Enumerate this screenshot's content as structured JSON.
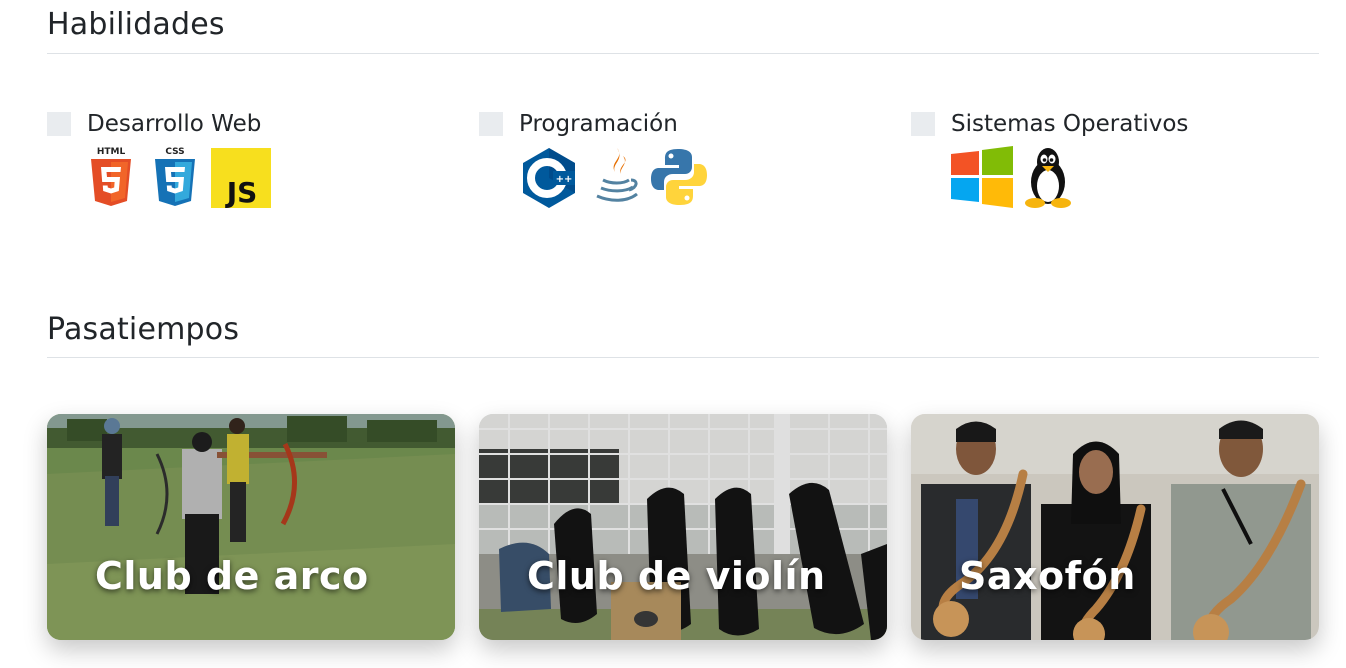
{
  "skills_section": {
    "title": "Habilidades",
    "groups": [
      {
        "label": "Desarrollo Web",
        "icons": [
          "html5-icon",
          "css3-icon",
          "javascript-icon"
        ],
        "icon_text": {
          "html": "HTML",
          "css": "CSS",
          "js": "JS"
        }
      },
      {
        "label": "Programación",
        "icons": [
          "cplusplus-icon",
          "java-icon",
          "python-icon"
        ]
      },
      {
        "label": "Sistemas Operativos",
        "icons": [
          "windows-icon",
          "linux-tux-icon"
        ]
      }
    ]
  },
  "hobbies_section": {
    "title": "Pasatiempos",
    "cards": [
      {
        "title": "Club de arco"
      },
      {
        "title": "Club de violín"
      },
      {
        "title": "Saxofón"
      }
    ]
  },
  "colors": {
    "text": "#212529",
    "divider": "#dee2e6",
    "html5": "#e44d26",
    "css3": "#1572b6",
    "javascript": "#f7df1e",
    "cpp": "#00599c",
    "python_blue": "#3776ab",
    "python_yellow": "#ffd43b"
  }
}
